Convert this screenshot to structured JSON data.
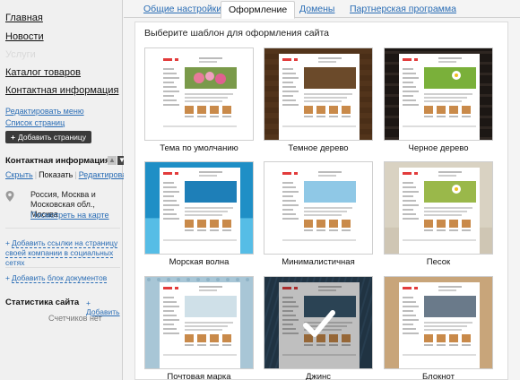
{
  "sidebar": {
    "nav": [
      {
        "label": "Главная",
        "enabled": true
      },
      {
        "label": "Новости",
        "enabled": true
      },
      {
        "label": "Услуги",
        "enabled": false
      },
      {
        "label": "Каталог товаров",
        "enabled": true
      },
      {
        "label": "Контактная информация",
        "enabled": true
      }
    ],
    "edit_menu": "Редактировать меню",
    "pages_list": "Список страниц",
    "add_page": "Добавить страницу",
    "contact": {
      "title": "Контактная информация",
      "hide": "Скрыть",
      "show": "Показать",
      "edit": "Редактировать",
      "address": "Россия, Москва и Московская обл., Москва",
      "map_link": "Посмотреть на карте",
      "add_social": "Добавить ссылки на страницу своей компании в социальных сетях",
      "add_docs": "Добавить блок документов"
    },
    "stats": {
      "title": "Статистика сайта",
      "add": "Добавить",
      "empty": "Счетчиков нет"
    }
  },
  "tabs": [
    {
      "label": "Общие настройки",
      "active": false
    },
    {
      "label": "Оформление",
      "active": true
    },
    {
      "label": "Домены",
      "active": false
    },
    {
      "label": "Партнерская программа",
      "active": false
    }
  ],
  "panel_title": "Выберите шаблон для оформления сайта",
  "templates": [
    {
      "name": "Тема по умолчанию",
      "bg": "#ffffff",
      "selected": false
    },
    {
      "name": "Темное дерево",
      "bg": "#4a2e17",
      "selected": false
    },
    {
      "name": "Черное дерево",
      "bg": "#1c1714",
      "selected": false
    },
    {
      "name": "Морская волна",
      "bg": "#2fa7d8",
      "selected": false
    },
    {
      "name": "Минималистичная",
      "bg": "#ffffff",
      "selected": false
    },
    {
      "name": "Песок",
      "bg": "#d8d0c0",
      "selected": false
    },
    {
      "name": "Почтовая марка",
      "bg": "#a8c6d6",
      "selected": false
    },
    {
      "name": "Джинс",
      "bg": "#2b4559",
      "selected": true
    },
    {
      "name": "Блокнот",
      "bg": "#c8a57a",
      "selected": false
    }
  ],
  "colors": {
    "link": "#2a6db5",
    "button_dark": "#3a3a3a",
    "logo_red": "#e23b3b"
  }
}
